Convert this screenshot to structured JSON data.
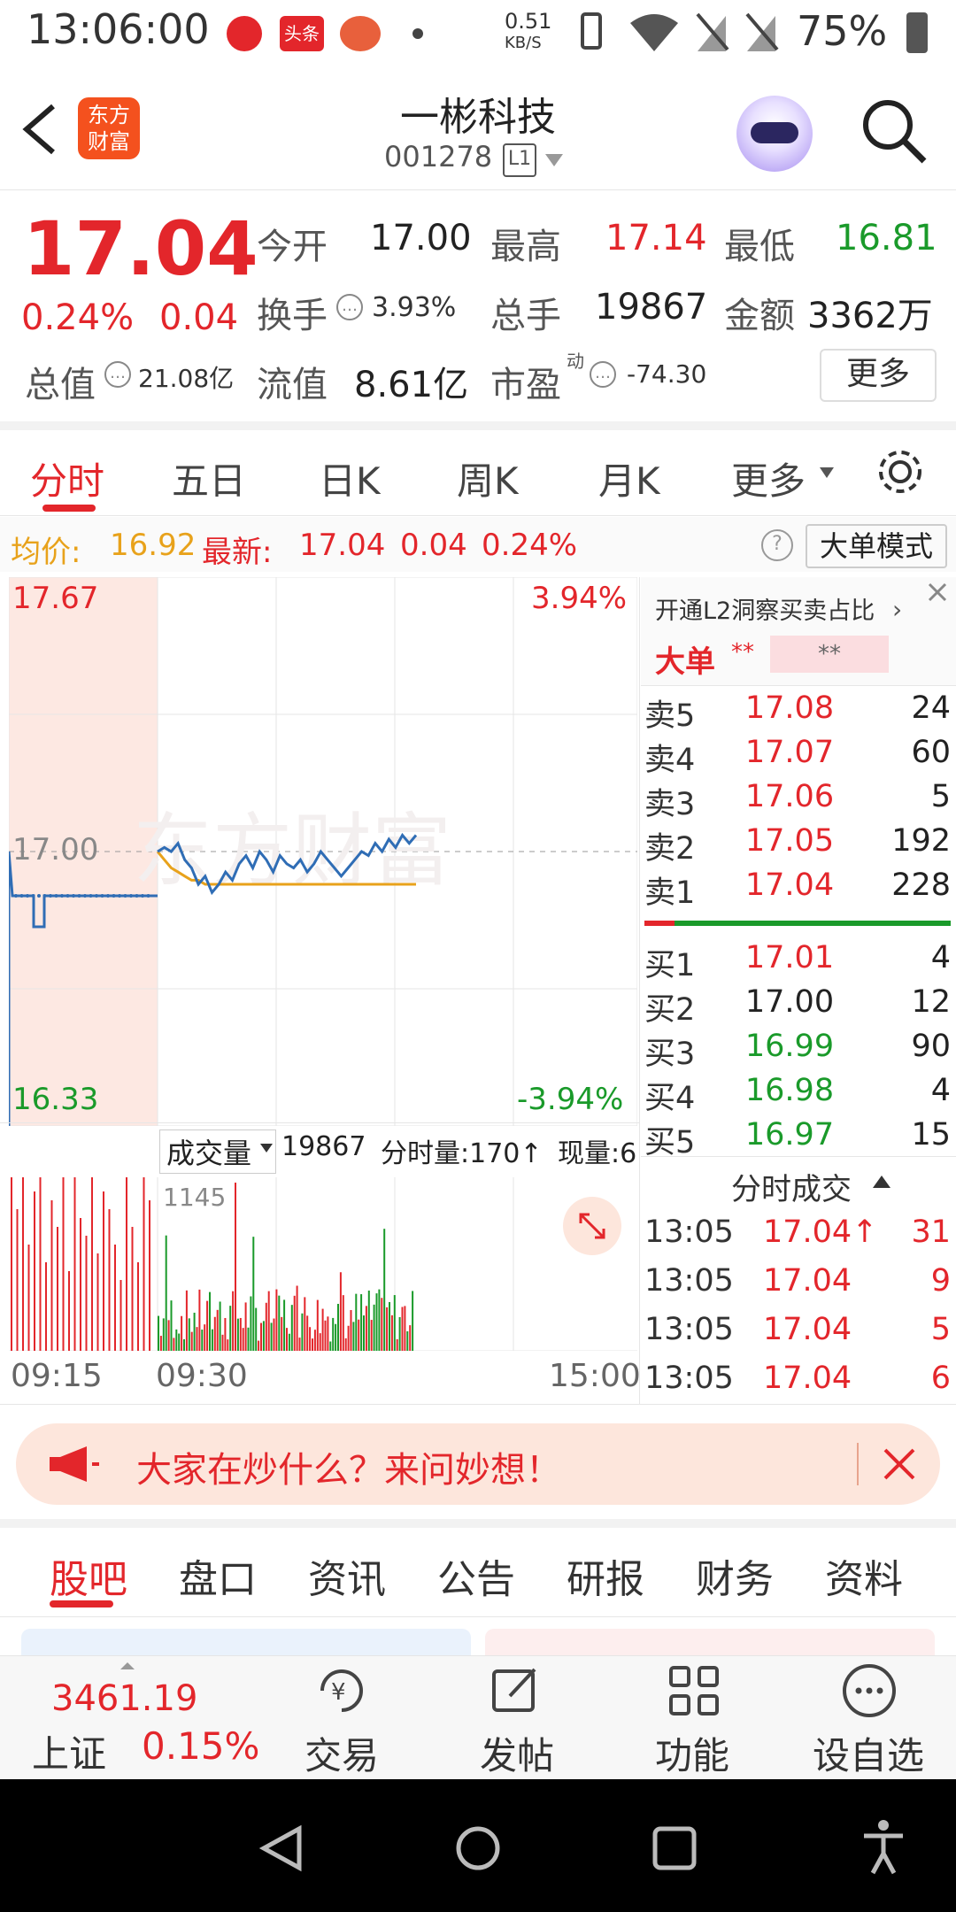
{
  "status": {
    "time": "13:06:00",
    "net": "0.51",
    "net_unit": "KB/S",
    "battery": "75%",
    "app_tag": "头条"
  },
  "header": {
    "logo": "东方财富",
    "title": "一彬科技",
    "code": "001278",
    "level": "L1"
  },
  "quote": {
    "price": "17.04",
    "change_pct": "0.24%",
    "change_val": "0.04",
    "open_label": "今开",
    "open": "17.00",
    "high_label": "最高",
    "high": "17.14",
    "low_label": "最低",
    "low": "16.81",
    "turnover_label": "换手",
    "turnover": "3.93%",
    "volume_label": "总手",
    "volume": "19867",
    "amount_label": "金额",
    "amount": "3362万",
    "mktcap_label": "总值",
    "mktcap": "21.08亿",
    "float_label": "流值",
    "float": "8.61亿",
    "pe_label": "市盈",
    "pe_sup": "动",
    "pe": "-74.30",
    "more": "更多"
  },
  "tabs": [
    "分时",
    "五日",
    "日K",
    "周K",
    "月K",
    "更多"
  ],
  "avg_row": {
    "avg_label": "均价:",
    "avg": "16.92",
    "latest_label": "最新:",
    "latest": "17.04",
    "chg": "0.04",
    "pct": "0.24%",
    "mode": "大单模式"
  },
  "chart_labels": {
    "high": "17.67",
    "high_pct": "3.94%",
    "mid": "17.00",
    "low": "16.33",
    "low_pct": "-3.94%",
    "watermark": "东方财富",
    "vol_max": "1145",
    "t1": "09:15",
    "t2": "09:30",
    "t3": "15:00"
  },
  "volume_bar": {
    "label": "成交量",
    "total": "19867",
    "minute": "分时量:170↑",
    "now": "现量:6"
  },
  "orderbook": {
    "l2": "开通L2洞察买卖占比",
    "big": "大单",
    "stars": "**",
    "asks": [
      {
        "name": "卖5",
        "price": "17.08",
        "qty": "24",
        "color": "red"
      },
      {
        "name": "卖4",
        "price": "17.07",
        "qty": "60",
        "color": "red"
      },
      {
        "name": "卖3",
        "price": "17.06",
        "qty": "5",
        "color": "red"
      },
      {
        "name": "卖2",
        "price": "17.05",
        "qty": "192",
        "color": "red"
      },
      {
        "name": "卖1",
        "price": "17.04",
        "qty": "228",
        "color": "red"
      }
    ],
    "bids": [
      {
        "name": "买1",
        "price": "17.01",
        "qty": "4",
        "color": "red"
      },
      {
        "name": "买2",
        "price": "17.00",
        "qty": "12",
        "color": "black"
      },
      {
        "name": "买3",
        "price": "16.99",
        "qty": "90",
        "color": "green"
      },
      {
        "name": "买4",
        "price": "16.98",
        "qty": "4",
        "color": "green"
      },
      {
        "name": "买5",
        "price": "16.97",
        "qty": "15",
        "color": "green"
      }
    ],
    "ticks_label": "分时成交",
    "ticks": [
      {
        "time": "13:05",
        "price": "17.04↑",
        "qty": "31"
      },
      {
        "time": "13:05",
        "price": "17.04",
        "qty": "9"
      },
      {
        "time": "13:05",
        "price": "17.04",
        "qty": "5"
      },
      {
        "time": "13:05",
        "price": "17.04",
        "qty": "6"
      }
    ]
  },
  "promo": {
    "text": "大家在炒什么？来问妙想！"
  },
  "bottom_tabs": [
    "股吧",
    "盘口",
    "资讯",
    "公告",
    "研报",
    "财务",
    "资料"
  ],
  "bottombar": {
    "index_value": "3461.19",
    "index_name": "上证",
    "index_pct": "0.15%",
    "items": [
      "交易",
      "发帖",
      "功能",
      "设自选"
    ]
  },
  "colors": {
    "red": "#e3262b",
    "green": "#1a9a2a",
    "accent": "#f4511e"
  },
  "chart_data": {
    "type": "line",
    "price_series": [
      17.0,
      17.01,
      17.0,
      17.02,
      16.98,
      16.96,
      16.92,
      16.94,
      16.9,
      16.92,
      16.95,
      16.93,
      16.97,
      16.99,
      16.96,
      17.0,
      16.98,
      16.95,
      16.99,
      16.97,
      16.96,
      16.98,
      16.95,
      16.97,
      17.0,
      16.98,
      16.96,
      16.94,
      16.96,
      16.98,
      17.0,
      16.99,
      17.02,
      17.0,
      17.03,
      17.01,
      17.04,
      17.02,
      17.04
    ],
    "avg_series": [
      17.0,
      16.98,
      16.96,
      16.95,
      16.94,
      16.93,
      16.93,
      16.92,
      16.92,
      16.92,
      16.92,
      16.92,
      16.92,
      16.92,
      16.92,
      16.92,
      16.92,
      16.92,
      16.92,
      16.92,
      16.92,
      16.92,
      16.92,
      16.92,
      16.92,
      16.92,
      16.92,
      16.92,
      16.92,
      16.92,
      16.92,
      16.92,
      16.92,
      16.92,
      16.92,
      16.92,
      16.92,
      16.92,
      16.92
    ],
    "ylim": [
      16.33,
      17.67
    ]
  }
}
